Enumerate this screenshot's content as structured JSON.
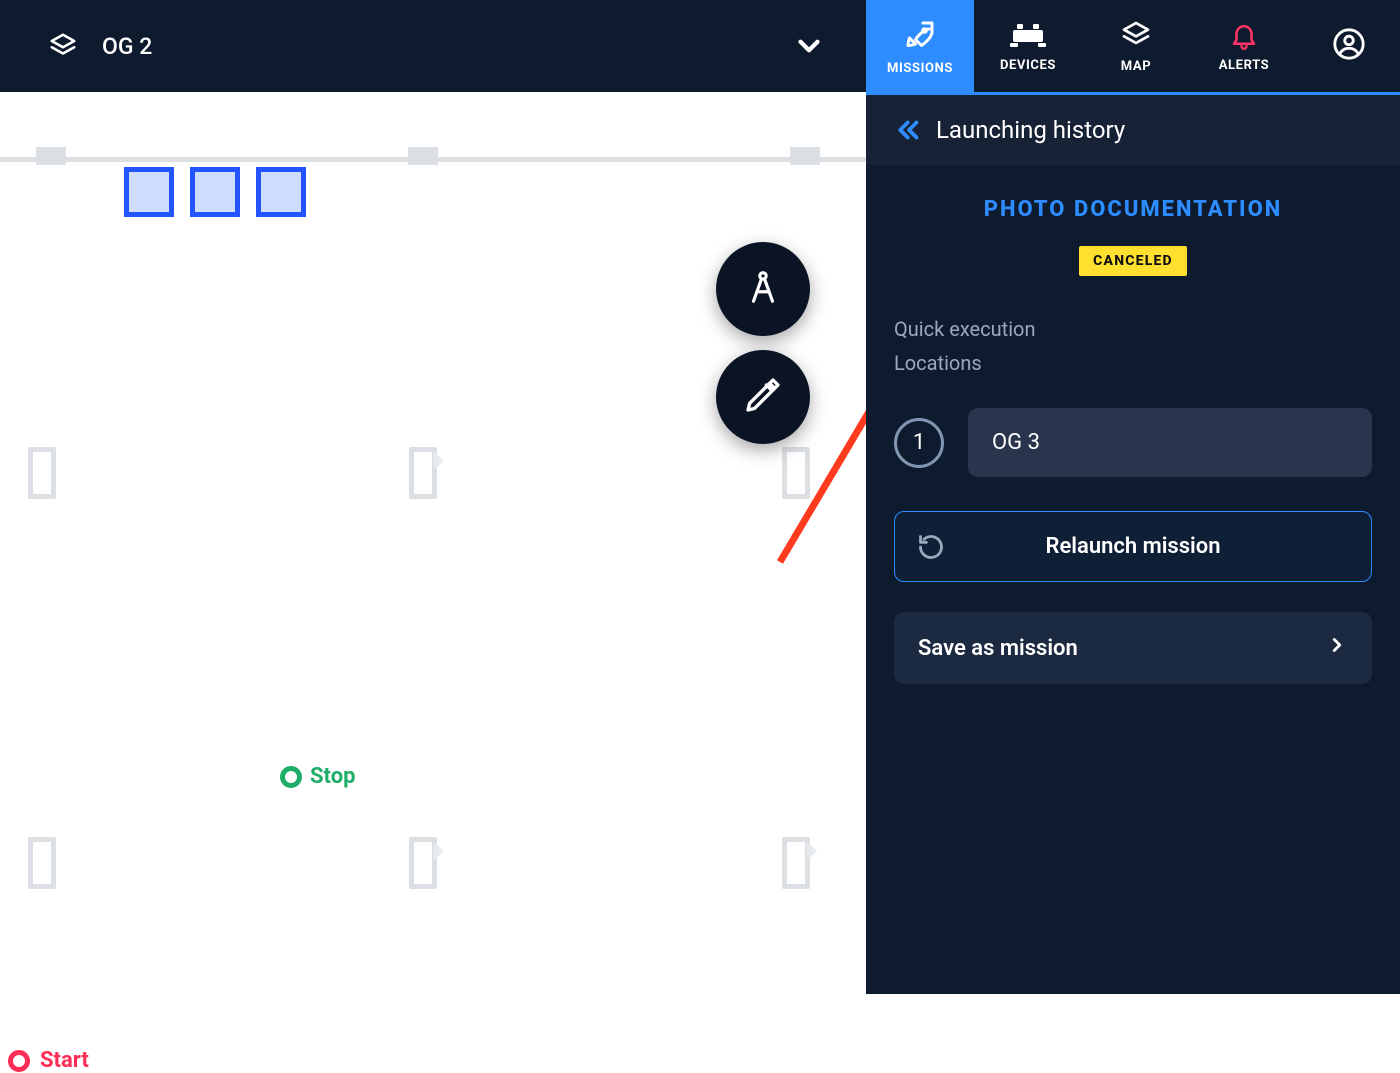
{
  "header": {
    "floor_selector": "OG 2",
    "tabs": {
      "missions": "MISSIONS",
      "devices": "DEVICES",
      "map": "MAP",
      "alerts": "ALERTS"
    }
  },
  "map": {
    "stop_label": "Stop",
    "start_label": "Start"
  },
  "panel": {
    "title": "Launching history",
    "section_title": "PHOTO DOCUMENTATION",
    "status_badge": "CANCELED",
    "meta_line1": "Quick execution",
    "meta_line2": "Locations",
    "step_number": "1",
    "step_location": "OG 3",
    "relaunch_label": "Relaunch mission",
    "save_label": "Save as mission"
  }
}
